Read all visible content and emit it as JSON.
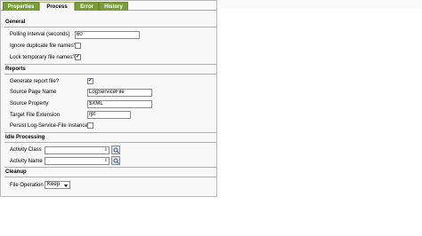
{
  "tabs": [
    {
      "label": "Properties"
    },
    {
      "label": "Process"
    },
    {
      "label": "Error"
    },
    {
      "label": "History"
    }
  ],
  "general": {
    "title": "General",
    "polling_label": "Polling Interval (seconds)",
    "polling_value": "60",
    "ignore_dup_label": "Ignore duplicate file names?",
    "ignore_dup_checked": "",
    "lock_temp_label": "Lock temporary file names?",
    "lock_temp_checked": "✓"
  },
  "reports": {
    "title": "Reports",
    "generate_label": "Generate report file?",
    "generate_checked": "✓",
    "source_page_label": "Source Page Name",
    "source_page_value": "LogServiceFile",
    "source_prop_label": "Source Property",
    "source_prop_value": "$XML",
    "target_ext_label": "Target File Extension",
    "target_ext_value": "rpt",
    "persist_label": "Persist Log-Service-File instances?",
    "persist_checked": ""
  },
  "idle": {
    "title": "Idle Processing",
    "activity_class_label": "Activity Class",
    "activity_class_value": "",
    "activity_name_label": "Activity Name",
    "activity_name_value": ""
  },
  "cleanup": {
    "title": "Cleanup",
    "file_op_label": "File Operation",
    "file_op_value": "Keep"
  },
  "colors": {
    "tab_green": "#7b9d39",
    "panel_bg": "#f8f8f8"
  }
}
